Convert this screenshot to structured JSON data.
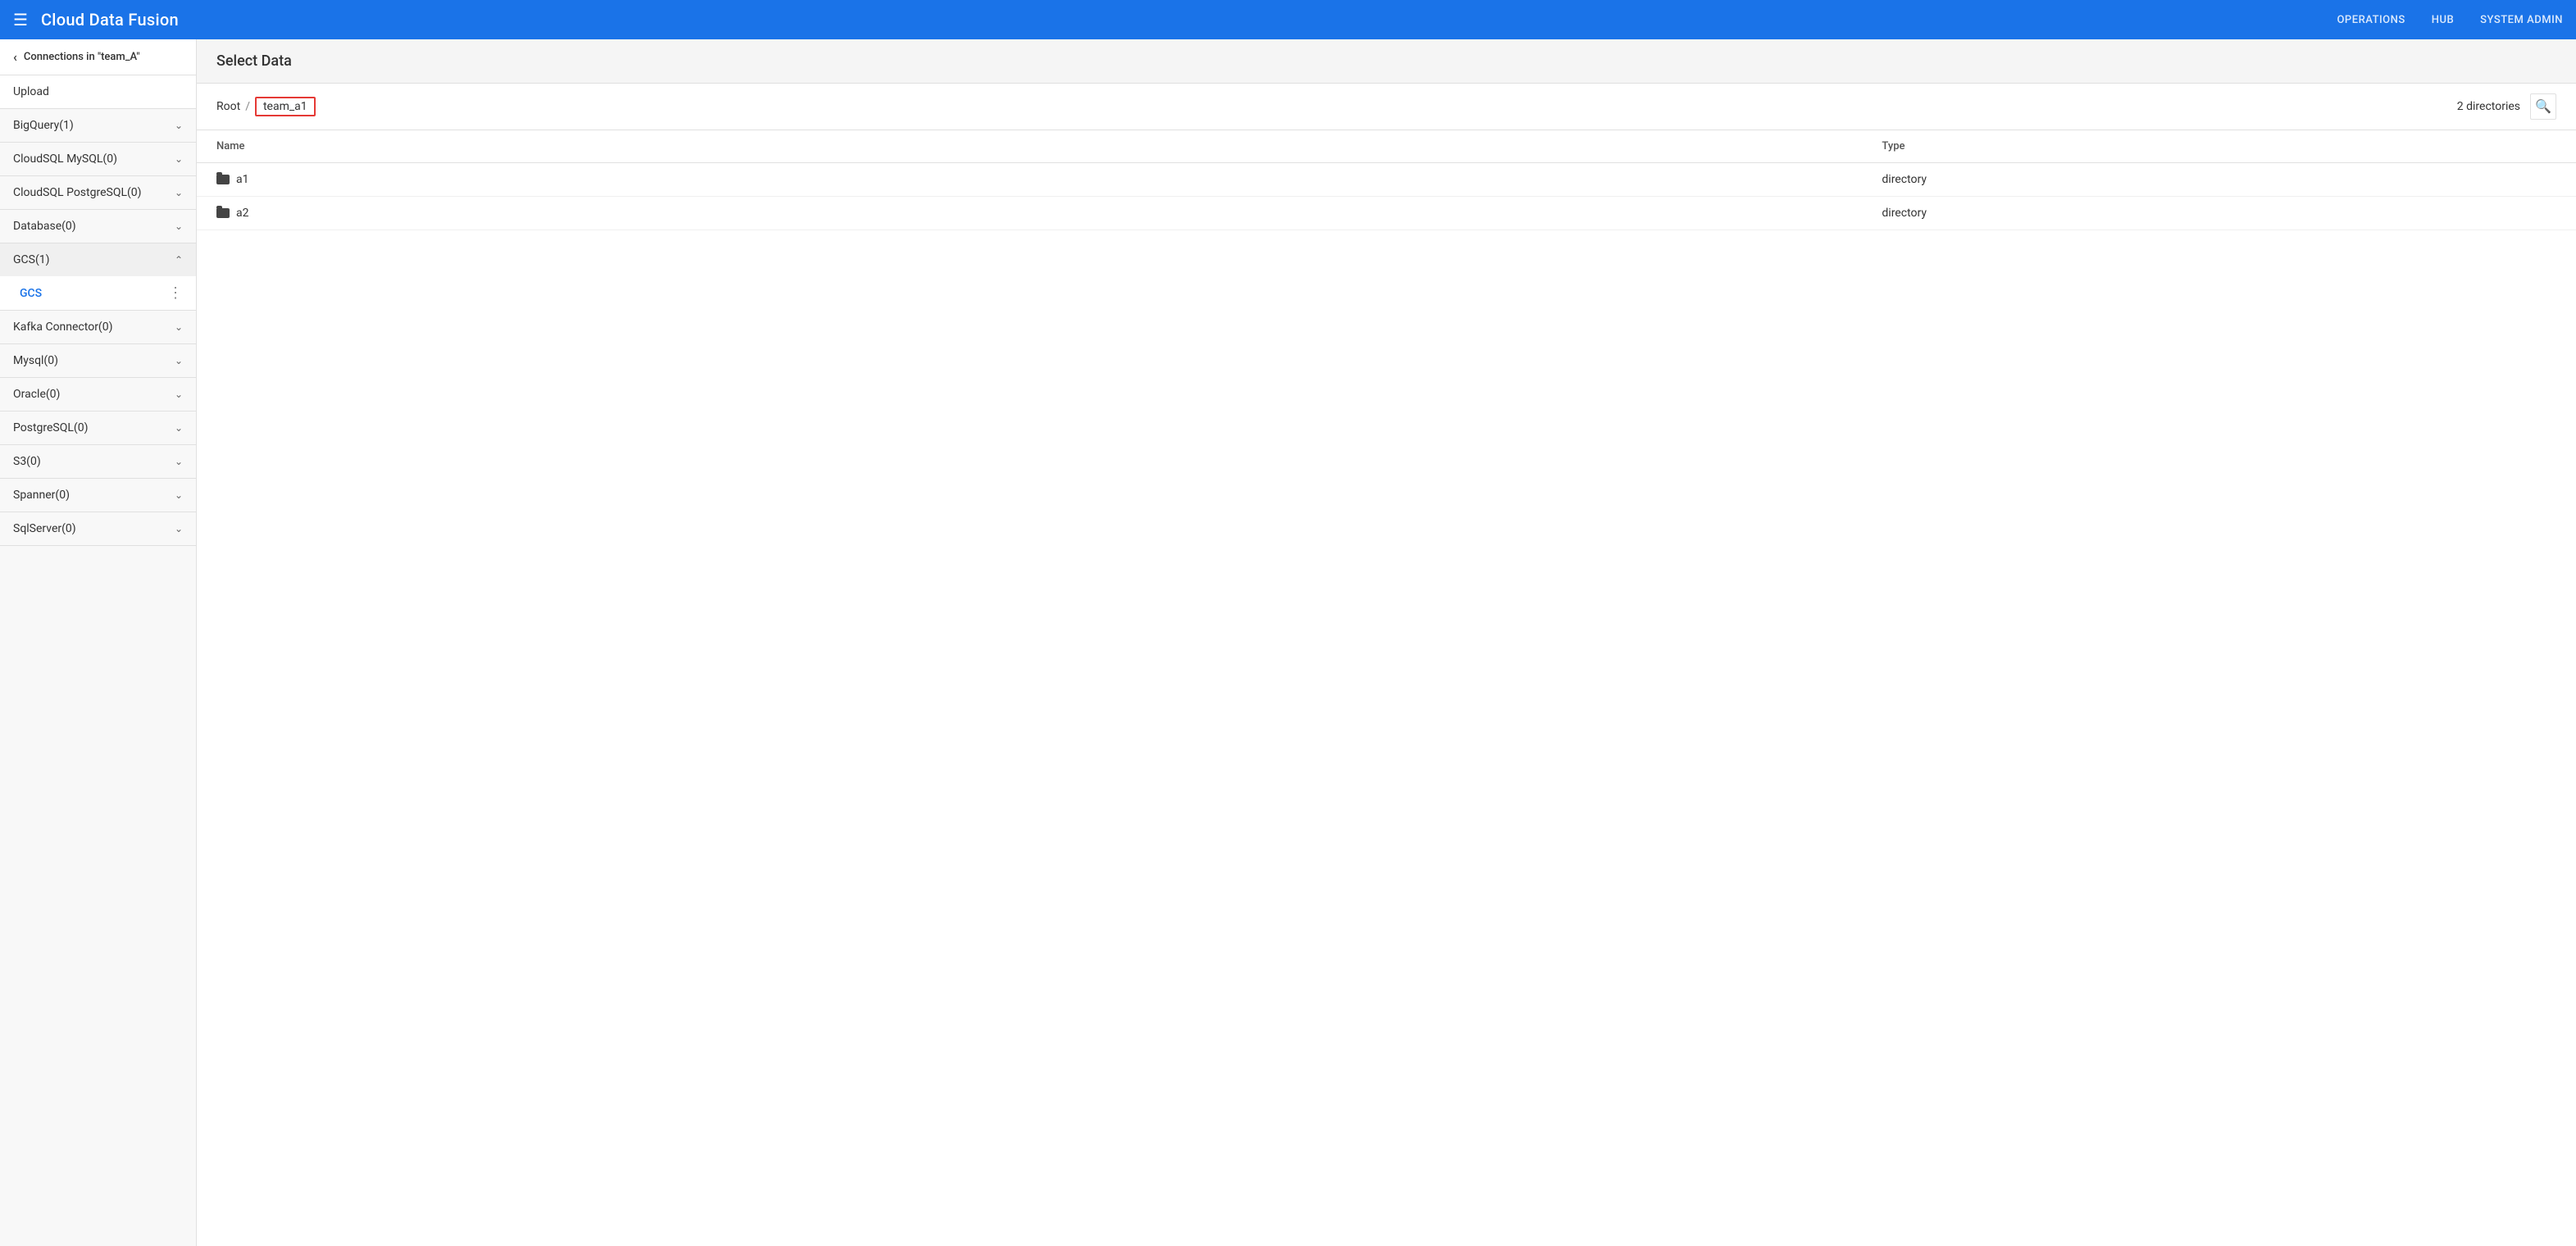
{
  "topnav": {
    "hamburger_label": "☰",
    "logo": "Cloud Data Fusion",
    "links": [
      {
        "id": "operations",
        "label": "OPERATIONS"
      },
      {
        "id": "hub",
        "label": "HUB"
      },
      {
        "id": "system-admin",
        "label": "SYSTEM ADMIN"
      }
    ]
  },
  "sidebar": {
    "back_label": "Connections in \"team_A\"",
    "upload_label": "Upload",
    "sections": [
      {
        "id": "bigquery",
        "label": "BigQuery(1)",
        "expanded": false
      },
      {
        "id": "cloudsql-mysql",
        "label": "CloudSQL MySQL(0)",
        "expanded": false
      },
      {
        "id": "cloudsql-postgresql",
        "label": "CloudSQL PostgreSQL(0)",
        "expanded": false
      },
      {
        "id": "database",
        "label": "Database(0)",
        "expanded": false
      },
      {
        "id": "gcs",
        "label": "GCS(1)",
        "expanded": true,
        "items": [
          {
            "id": "gcs-item",
            "label": "GCS"
          }
        ]
      },
      {
        "id": "kafka",
        "label": "Kafka Connector(0)",
        "expanded": false
      },
      {
        "id": "mysql",
        "label": "Mysql(0)",
        "expanded": false
      },
      {
        "id": "oracle",
        "label": "Oracle(0)",
        "expanded": false
      },
      {
        "id": "postgresql",
        "label": "PostgreSQL(0)",
        "expanded": false
      },
      {
        "id": "s3",
        "label": "S3(0)",
        "expanded": false
      },
      {
        "id": "spanner",
        "label": "Spanner(0)",
        "expanded": false
      },
      {
        "id": "sqlserver",
        "label": "SqlServer(0)",
        "expanded": false
      }
    ]
  },
  "main": {
    "title": "Select Data",
    "breadcrumb": {
      "root": "Root",
      "separator": "/",
      "current": "team_a1"
    },
    "directories_count": "2 directories",
    "table": {
      "columns": [
        {
          "id": "name",
          "label": "Name"
        },
        {
          "id": "type",
          "label": "Type"
        }
      ],
      "rows": [
        {
          "name": "a1",
          "type": "directory"
        },
        {
          "name": "a2",
          "type": "directory"
        }
      ]
    }
  },
  "icons": {
    "hamburger": "☰",
    "chevron_down": "∨",
    "chevron_up": "∧",
    "search": "🔍",
    "dots": "⋮",
    "arrow_left": "‹"
  }
}
